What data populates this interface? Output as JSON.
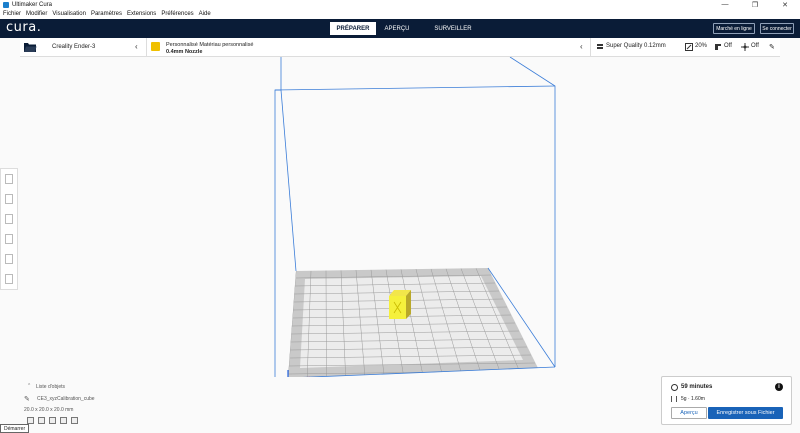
{
  "window": {
    "title": "Ultimaker Cura",
    "controls": [
      "—",
      "❐",
      "✕"
    ]
  },
  "menu": [
    "Fichier",
    "Modifier",
    "Visualisation",
    "Paramètres",
    "Extensions",
    "Préférences",
    "Aide"
  ],
  "header": {
    "logo": "cura.",
    "tabs": [
      "PRÉPARER",
      "APERÇU",
      "SURVEILLER"
    ],
    "marketplace": "Marché en ligne",
    "signin": "Se connecter"
  },
  "machine": {
    "name": "Creality Ender-3"
  },
  "material": {
    "line1": "Personnalisé Matériau personnalisé",
    "line2": "0.4mm Nozzle"
  },
  "print_settings": {
    "profile": "Super Quality 0.12mm",
    "infill": "20%",
    "support": "Off",
    "adhesion": "Off"
  },
  "objects": {
    "title": "Liste d'objets",
    "file": "CE3_xyzCalibration_cube",
    "dims": "20.0 x 20.0 x 20.0 mm"
  },
  "taskbar": {
    "start": "Démarrer"
  },
  "estimate": {
    "time": "59 minutes",
    "info": "i",
    "material": "5g · 1.60m",
    "preview_button": "Aperçu",
    "save_button": "Enregistrer sous Fichier"
  },
  "colors": {
    "header": "#0a1c37",
    "accent": "#1963b8",
    "model": "#f3ef3a",
    "buildvolume": "#3b7dd8"
  }
}
